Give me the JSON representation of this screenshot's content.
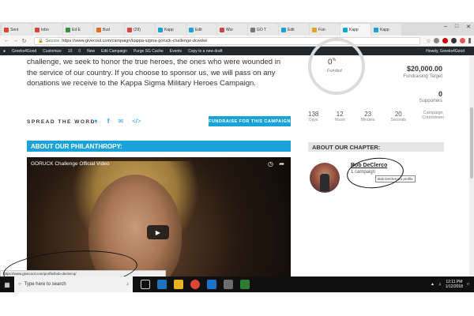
{
  "browser": {
    "tabs": [
      {
        "label": "Sent",
        "color": "#db4437"
      },
      {
        "label": "Inbo",
        "color": "#db4437"
      },
      {
        "label": "Ed E",
        "color": "#3b8e3b"
      },
      {
        "label": "Bud",
        "color": "#e06c1f"
      },
      {
        "label": "(29)",
        "color": "#db4437"
      },
      {
        "label": "Kapp",
        "color": "#1aa3d9"
      },
      {
        "label": "Edit",
        "color": "#1aa3d9"
      },
      {
        "label": "Wor",
        "color": "#c44"
      },
      {
        "label": "GO T",
        "color": "#777"
      },
      {
        "label": "Edit",
        "color": "#1aa3d9"
      },
      {
        "label": "Fun",
        "color": "#e0a21f"
      },
      {
        "label": "Kapp",
        "color": "#1aa3d9"
      },
      {
        "label": "Kapp",
        "color": "#1aa3d9"
      }
    ],
    "secure_label": "Secure",
    "url": "https://www.givecool.com/campaign/kappa-sigma-goruck-challenge-dcwdw/"
  },
  "wpbar": {
    "items": [
      "Greeks4Good",
      "Customize",
      "10",
      "0",
      "New",
      "Edit Campaign",
      "Purge SG Cache",
      "Events",
      "Copy to a new draft"
    ],
    "howdy": "Howdy, Greeks4Good"
  },
  "story_text": "challenge, we seek to honor the true heroes, the ones who were wounded in the service of our country. If you choose to sponsor us, we will pass on any donations we receive to the Kappa Sigma Military Heroes Campaign.",
  "share": {
    "spread_label": "SPREAD THE WORD:",
    "fundraise_button": "FUNDRAISE FOR THIS CAMPAIGN"
  },
  "philanthropy": {
    "heading": "ABOUT OUR PHILANTHROPY:",
    "video_title": "GORUCK Challenge Official Video"
  },
  "stats": {
    "funded_pct": "0",
    "pct_sign": "%",
    "funded_label": "Funded",
    "target_value": "$20,000.00",
    "target_label": "Fundraising Target",
    "supporters_value": "0",
    "supporters_label": "Supporters"
  },
  "countdown": [
    {
      "n": "138",
      "u": "Days"
    },
    {
      "n": "12",
      "u": "Hours"
    },
    {
      "n": "23",
      "u": "Minutes"
    },
    {
      "n": "20",
      "u": "Seconds"
    },
    {
      "n": "Campaign",
      "u": "Countdown"
    }
  ],
  "chapter": {
    "heading": "ABOUT OUR CHAPTER:",
    "name": "Bob DeClerco",
    "sub": "1 campaign",
    "tooltip": "Bob DeClerco's profile"
  },
  "status_url": "https://www.givecool.com/profile/bob-declercq/",
  "taskbar": {
    "search_placeholder": "Type here to search",
    "time": "12:11 PM",
    "date": "1/12/2018"
  },
  "colors": {
    "accent": "#1aa3d9",
    "wpbar": "#23282d",
    "taskbar": "#101010"
  }
}
